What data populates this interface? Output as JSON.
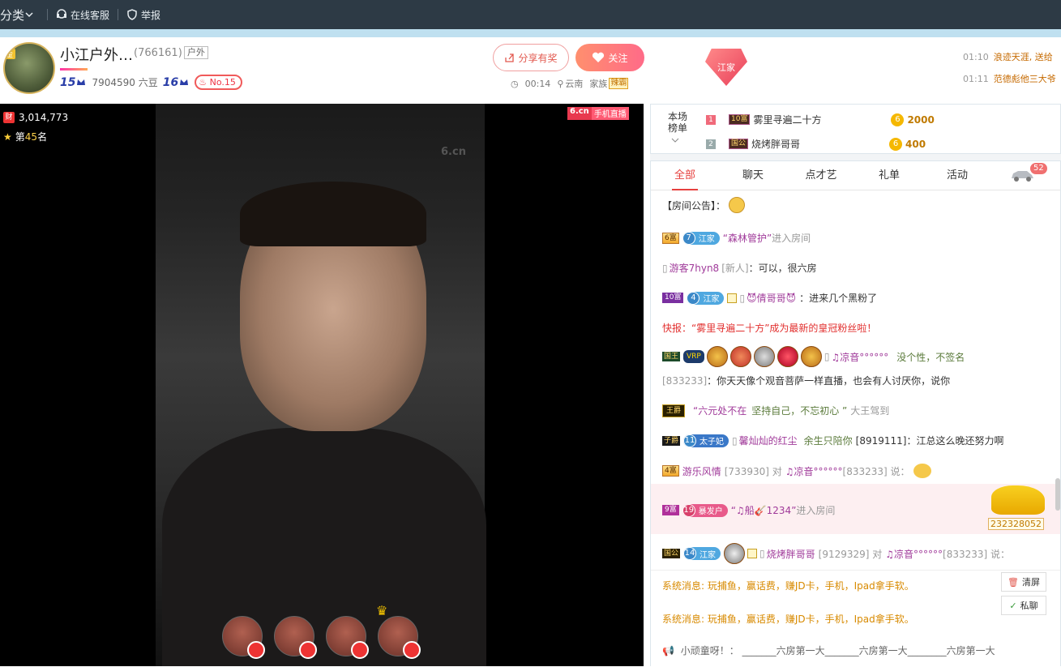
{
  "topbar": {
    "category": "分类",
    "service": "在线客服",
    "report": "举报"
  },
  "anchor": {
    "name": "小江户外…",
    "id": "(766161)",
    "tag": "户外",
    "level1": "15",
    "beans": "7904590 六豆",
    "level2": "16",
    "rank": "No.15",
    "avatar_badge": "金"
  },
  "buttons": {
    "share": "分享有奖",
    "follow": "关注"
  },
  "meta": {
    "duration": "00:14",
    "location": "云南",
    "family_label": "家族",
    "family_tag": "辣霸"
  },
  "jiajia": "江家",
  "feed": [
    {
      "time": "01:10",
      "text": "浪迹天涯, 送给"
    },
    {
      "time": "01:11",
      "text": "范德彪他三大爷"
    }
  ],
  "video": {
    "wealth": "3,014,773",
    "rank_prefix": "第",
    "rank_num": "45",
    "rank_suffix": "名",
    "logo_a": "6.cn",
    "logo_b": "手机直播",
    "watermark": "6.cn"
  },
  "board": {
    "label": "本场榜单",
    "rows": [
      {
        "no": "1",
        "tag": "10富",
        "name": "雾里寻遍二十方",
        "coin": "6",
        "value": "2000"
      },
      {
        "no": "2",
        "tag": "国公",
        "name": "烧烤胖哥哥",
        "coin": "6",
        "value": "400"
      }
    ]
  },
  "tabs": [
    "全部",
    "聊天",
    "点才艺",
    "礼单",
    "活动"
  ],
  "car_count": "52",
  "msgs": {
    "m1": "【房间公告】：",
    "m2_tag": "6富",
    "m2_fan_n": "7",
    "m2_fan": "江家",
    "m2_name": "“森林管护”",
    "m2_text": "进入房间",
    "m3_name": "游客7hyn8",
    "m3_tag": "[新人]",
    "m3_text": "：可以，很六房",
    "m4_tag": "10富",
    "m4_fan_n": "4",
    "m4_fan": "江家",
    "m4_name": "😈倩哥哥😈",
    "m4_text": "：进来几个黑粉了",
    "m5": "快报：“雾里寻遍二十方”成为最新的皇冠粉丝啦！",
    "m6_tag": "国王",
    "m6_vip": "VRP",
    "m6_name": "♫凉音°°°°°°",
    "m6_text": "没个性，不签名",
    "m7_id": "[833233]",
    "m7_text": "：你天天像个观音菩萨一样直播，也会有人讨厌你，说你",
    "m8_tag": "王爵",
    "m8_name": "“六元处不在",
    "m8_text": "坚持自己，不忘初心 ”",
    "m8_after": "大王驾到",
    "m9_tag": "子爵",
    "m9_fan_n": "11",
    "m9_fan": "太子妃",
    "m9_name": "馨灿灿的红尘",
    "m9_sig": "余生只陪你",
    "m9_text": "[8919111]：江总这么晚还努力啊",
    "m10_tag": "4富",
    "m10_name": "游乐风情",
    "m10_text": "[733930] 对",
    "m10_to": "♫凉音°°°°°°",
    "m10_id": "[833233] 说：",
    "m11_tag": "9富",
    "m11_fan_n": "19",
    "m11_fan": "暴发户",
    "m11_name": "“♫船🎸1234”",
    "m11_text": "进入房间",
    "m11_id": "232328052",
    "m12_tag": "国公",
    "m12_fan_n": "14",
    "m12_fan": "江家",
    "m12_name": "烧烤胖哥哥",
    "m12_text": "[9129329] 对",
    "m12_to": "♫凉音°°°°°°",
    "m12_id": "[833233] 说："
  },
  "system": {
    "s1": "系统消息: 玩捕鱼，赢话费，赚JD卡，手机，Ipad拿手软。",
    "s2": "系统消息: 玩捕鱼，赢话费，赚JD卡，手机，Ipad拿手软。",
    "clear": "清屏",
    "private": "私聊",
    "bottom_name": "小顽童呀！：",
    "bottom_text": "_______六房第一大_______六房第一大________六房第一大"
  }
}
